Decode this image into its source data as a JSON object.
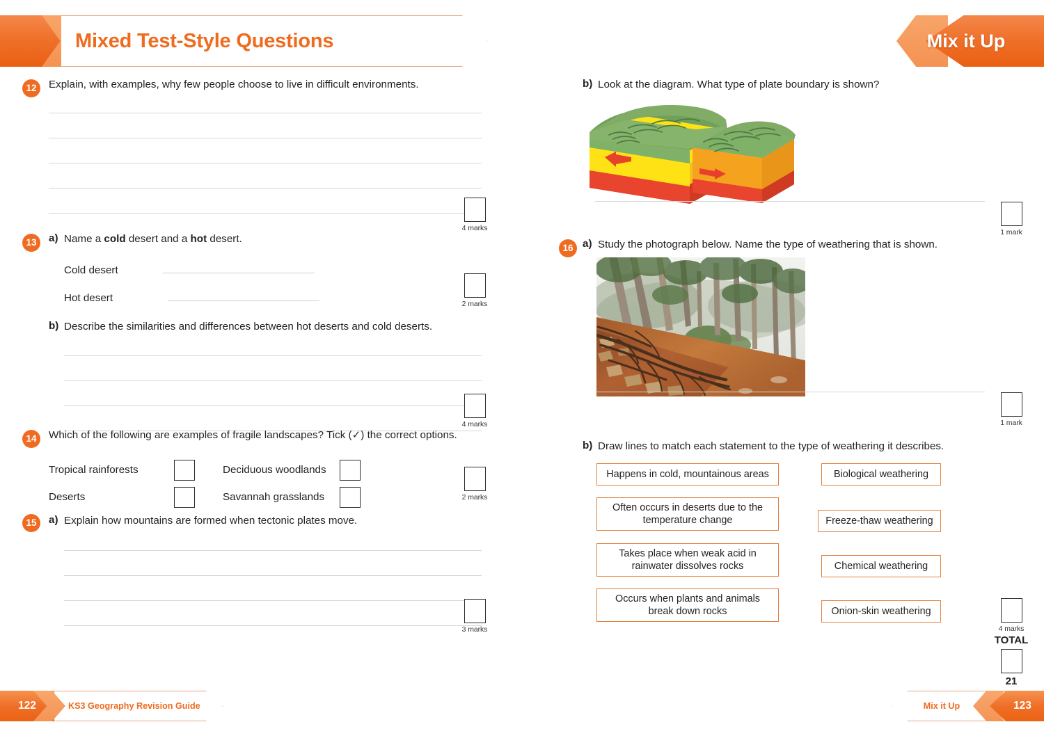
{
  "header": {
    "title": "Mixed Test-Style Questions",
    "section_tab": "Mix it Up"
  },
  "left_page": {
    "questions": [
      {
        "number": "12",
        "text": "Explain, with examples, why few people choose to live in difficult environments.",
        "lines": 5,
        "marks": "4 marks"
      },
      {
        "number": "13",
        "part_a_label": "a)",
        "part_a_text_pre": "Name a ",
        "part_a_bold1": "cold",
        "part_a_text_mid": " desert and a ",
        "part_a_bold2": "hot",
        "part_a_text_post": " desert.",
        "field_cold": "Cold desert",
        "field_hot": "Hot desert",
        "marks_a": "2 marks",
        "part_b_label": "b)",
        "part_b_text": "Describe the similarities and differences between hot deserts and cold deserts.",
        "lines_b": 4,
        "marks_b": "4 marks"
      },
      {
        "number": "14",
        "text": "Which of the following are examples of fragile landscapes? Tick (✓) the correct options.",
        "options": [
          "Tropical rainforests",
          "Deciduous woodlands",
          "Deserts",
          "Savannah grasslands"
        ],
        "marks": "2 marks"
      },
      {
        "number": "15",
        "part_a_label": "a)",
        "part_a_text": "Explain how mountains are formed when tectonic plates move.",
        "lines": 4,
        "marks": "3 marks"
      }
    ]
  },
  "right_page": {
    "q15b": {
      "part_label": "b)",
      "text": "Look at the diagram. What type of plate boundary is shown?",
      "diagram_name": "plate-boundary-block-diagram",
      "marks": "1 mark"
    },
    "q16": {
      "number": "16",
      "part_a_label": "a)",
      "part_a_text": "Study the photograph below. Name the type of weathering that is shown.",
      "photo_name": "exposed-tree-roots-slope-photo",
      "marks_a": "1 mark",
      "part_b_label": "b)",
      "part_b_text": "Draw lines to match each statement to the type of weathering it describes.",
      "statements": [
        "Happens in cold, mountainous areas",
        "Often occurs in deserts due to the temperature change",
        "Takes place when weak acid in rainwater dissolves rocks",
        "Occurs when plants and animals break down rocks"
      ],
      "answers": [
        "Biological weathering",
        "Freeze-thaw weathering",
        "Chemical weathering",
        "Onion-skin weathering"
      ],
      "marks_b": "4 marks"
    },
    "total_label": "TOTAL",
    "total_value": "21"
  },
  "footer": {
    "left_page_number": "122",
    "left_text": "KS3 Geography Revision Guide",
    "right_text": "Mix it Up",
    "right_page_number": "123"
  },
  "colors": {
    "brand_orange": "#ef6b1f",
    "box_border": "#e2813f",
    "rule_gray": "#d6d6d6"
  }
}
